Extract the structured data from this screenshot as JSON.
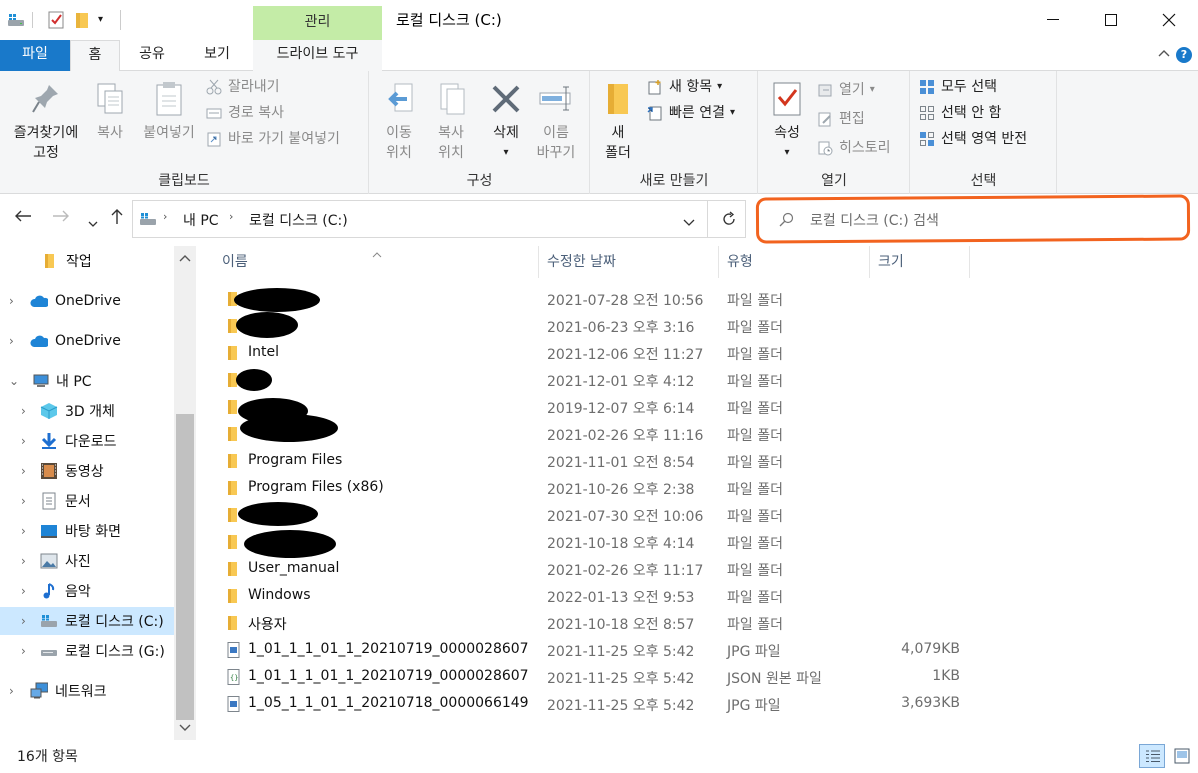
{
  "window": {
    "title": "로컬 디스크 (C:)",
    "contextual_tab": "관리",
    "minimize": "—",
    "maximize": "☐",
    "close": "✕"
  },
  "ribbon_tabs": {
    "file": "파일",
    "home": "홈",
    "share": "공유",
    "view": "보기",
    "drive_tools": "드라이브 도구"
  },
  "ribbon": {
    "clipboard": {
      "label": "클립보드",
      "pin_line1": "즐겨찾기에",
      "pin_line2": "고정",
      "copy": "복사",
      "paste": "붙여넣기",
      "cut": "잘라내기",
      "copy_path": "경로 복사",
      "paste_shortcut": "바로 가기 붙여넣기"
    },
    "organize": {
      "label": "구성",
      "move_line1": "이동",
      "move_line2": "위치",
      "copyto_line1": "복사",
      "copyto_line2": "위치",
      "delete": "삭제",
      "rename_line1": "이름",
      "rename_line2": "바꾸기"
    },
    "new": {
      "label": "새로 만들기",
      "folder_line1": "새",
      "folder_line2": "폴더",
      "new_item": "새 항목",
      "easy_access": "빠른 연결"
    },
    "open": {
      "label": "열기",
      "properties": "속성",
      "open": "열기",
      "edit": "편집",
      "history": "히스토리"
    },
    "select": {
      "label": "선택",
      "select_all": "모두 선택",
      "select_none": "선택 안 함",
      "invert": "선택 영역 반전"
    }
  },
  "address": {
    "path": [
      "내 PC",
      "로컬 디스크 (C:)"
    ],
    "search_placeholder": "로컬 디스크 (C:) 검색"
  },
  "nav": {
    "items": [
      {
        "label": "작업",
        "icon": "folder-icon"
      },
      {
        "label": "OneDrive",
        "icon": "cloud-icon"
      },
      {
        "label": "OneDrive",
        "icon": "cloud-icon"
      },
      {
        "label": "내 PC",
        "icon": "pc-icon"
      },
      {
        "label": "3D 개체",
        "icon": "cube-icon"
      },
      {
        "label": "다운로드",
        "icon": "download-icon"
      },
      {
        "label": "동영상",
        "icon": "video-icon"
      },
      {
        "label": "문서",
        "icon": "document-icon"
      },
      {
        "label": "바탕 화면",
        "icon": "desktop-icon"
      },
      {
        "label": "사진",
        "icon": "picture-icon"
      },
      {
        "label": "음악",
        "icon": "music-icon"
      },
      {
        "label": "로컬 디스크 (C:)",
        "icon": "drive-icon"
      },
      {
        "label": "로컬 디스크 (G:)",
        "icon": "drive-icon"
      },
      {
        "label": "네트워크",
        "icon": "network-icon"
      }
    ]
  },
  "columns": {
    "name": "이름",
    "date": "수정한 날짜",
    "type": "유형",
    "size": "크기"
  },
  "files": [
    {
      "name": "",
      "date": "2021-07-28 오전 10:56",
      "type": "파일 폴더",
      "size": "",
      "icon": "folder-icon"
    },
    {
      "name": "",
      "date": "2021-06-23 오후 3:16",
      "type": "파일 폴더",
      "size": "",
      "icon": "folder-icon"
    },
    {
      "name": "Intel",
      "date": "2021-12-06 오전 11:27",
      "type": "파일 폴더",
      "size": "",
      "icon": "folder-icon"
    },
    {
      "name": "",
      "date": "2021-12-01 오후 4:12",
      "type": "파일 폴더",
      "size": "",
      "icon": "folder-icon"
    },
    {
      "name": "",
      "date": "2019-12-07 오후 6:14",
      "type": "파일 폴더",
      "size": "",
      "icon": "folder-icon"
    },
    {
      "name": "",
      "date": "2021-02-26 오후 11:16",
      "type": "파일 폴더",
      "size": "",
      "icon": "folder-icon"
    },
    {
      "name": "Program Files",
      "date": "2021-11-01 오전 8:54",
      "type": "파일 폴더",
      "size": "",
      "icon": "folder-icon"
    },
    {
      "name": "Program Files (x86)",
      "date": "2021-10-26 오후 2:38",
      "type": "파일 폴더",
      "size": "",
      "icon": "folder-icon"
    },
    {
      "name": "",
      "date": "2021-07-30 오전 10:06",
      "type": "파일 폴더",
      "size": "",
      "icon": "folder-icon"
    },
    {
      "name": "",
      "date": "2021-10-18 오후 4:14",
      "type": "파일 폴더",
      "size": "",
      "icon": "folder-icon"
    },
    {
      "name": "User_manual",
      "date": "2021-02-26 오후 11:17",
      "type": "파일 폴더",
      "size": "",
      "icon": "folder-icon"
    },
    {
      "name": "Windows",
      "date": "2022-01-13 오전 9:53",
      "type": "파일 폴더",
      "size": "",
      "icon": "folder-icon"
    },
    {
      "name": "사용자",
      "date": "2021-10-18 오전 8:57",
      "type": "파일 폴더",
      "size": "",
      "icon": "folder-icon"
    },
    {
      "name": "1_01_1_1_01_1_20210719_0000028607",
      "date": "2021-11-25 오후 5:42",
      "type": "JPG 파일",
      "size": "4,079KB",
      "icon": "image-file-icon"
    },
    {
      "name": "1_01_1_1_01_1_20210719_0000028607",
      "date": "2021-11-25 오후 5:42",
      "type": "JSON 원본 파일",
      "size": "1KB",
      "icon": "json-file-icon"
    },
    {
      "name": "1_05_1_1_01_1_20210718_0000066149",
      "date": "2021-11-25 오후 5:42",
      "type": "JPG 파일",
      "size": "3,693KB",
      "icon": "image-file-icon"
    }
  ],
  "status": {
    "count": "16개 항목"
  },
  "colors": {
    "accent": "#1979ca",
    "manage_tab": "#c4eca7",
    "highlight": "#f2631f",
    "selection": "#cce8ff",
    "folder": "#f8c853"
  }
}
